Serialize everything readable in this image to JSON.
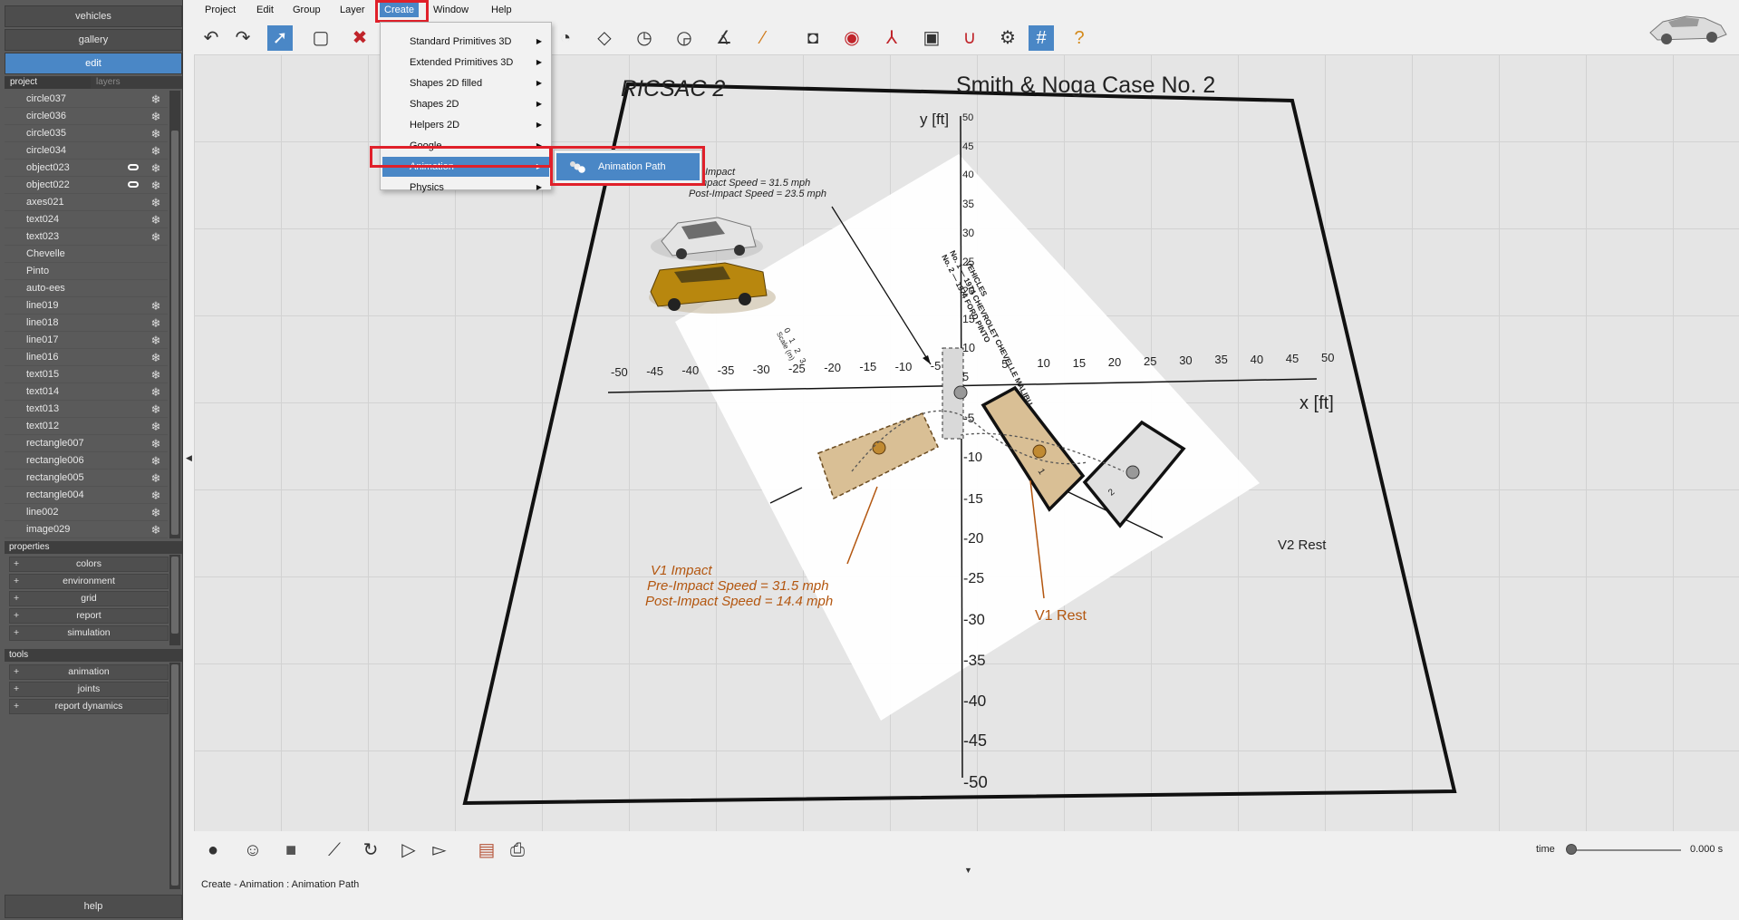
{
  "sidebar": {
    "top_buttons": [
      "vehicles",
      "gallery",
      "edit"
    ],
    "tabs": {
      "project": "project",
      "layers": "layers"
    },
    "project_items": [
      {
        "label": "circle037",
        "link": false,
        "gear": true
      },
      {
        "label": "circle036",
        "link": false,
        "gear": true
      },
      {
        "label": "circle035",
        "link": false,
        "gear": true
      },
      {
        "label": "circle034",
        "link": false,
        "gear": true
      },
      {
        "label": "object023",
        "link": true,
        "gear": true
      },
      {
        "label": "object022",
        "link": true,
        "gear": true
      },
      {
        "label": "axes021",
        "link": false,
        "gear": true
      },
      {
        "label": "text024",
        "link": false,
        "gear": true
      },
      {
        "label": "text023",
        "link": false,
        "gear": true
      },
      {
        "label": "Chevelle",
        "link": false,
        "gear": false
      },
      {
        "label": "Pinto",
        "link": false,
        "gear": false
      },
      {
        "label": "auto-ees",
        "link": false,
        "gear": false
      },
      {
        "label": "line019",
        "link": false,
        "gear": true
      },
      {
        "label": "line018",
        "link": false,
        "gear": true
      },
      {
        "label": "line017",
        "link": false,
        "gear": true
      },
      {
        "label": "line016",
        "link": false,
        "gear": true
      },
      {
        "label": "text015",
        "link": false,
        "gear": true
      },
      {
        "label": "text014",
        "link": false,
        "gear": true
      },
      {
        "label": "text013",
        "link": false,
        "gear": true
      },
      {
        "label": "text012",
        "link": false,
        "gear": true
      },
      {
        "label": "rectangle007",
        "link": false,
        "gear": true
      },
      {
        "label": "rectangle006",
        "link": false,
        "gear": true
      },
      {
        "label": "rectangle005",
        "link": false,
        "gear": true
      },
      {
        "label": "rectangle004",
        "link": false,
        "gear": true
      },
      {
        "label": "line002",
        "link": false,
        "gear": true
      },
      {
        "label": "image029",
        "link": false,
        "gear": true
      }
    ],
    "properties_title": "properties",
    "properties": [
      "colors",
      "environment",
      "grid",
      "report",
      "simulation"
    ],
    "tools_title": "tools",
    "tools": [
      "animation",
      "joints",
      "report dynamics"
    ],
    "help": "help"
  },
  "menubar": [
    "Project",
    "Edit",
    "Group",
    "Layer",
    "Create",
    "Window",
    "Help"
  ],
  "create_menu": {
    "items": [
      "Standard Primitives 3D",
      "Extended Primitives 3D",
      "Shapes 2D filled",
      "Shapes 2D",
      "Helpers 2D",
      "Google",
      "Animation",
      "Physics"
    ],
    "highlighted": "Animation",
    "submenu": [
      "Animation Path"
    ]
  },
  "scene": {
    "title_left": "RICSAC 2",
    "title_right": "Smith & Noga Case No. 2",
    "y_axis_label": "y [ft]",
    "x_axis_label": "x [ft]",
    "x_ticks": [
      "-50",
      "-45",
      "-40",
      "-35",
      "-30",
      "-25",
      "-20",
      "-15",
      "-10",
      "-5",
      "0",
      "5",
      "10",
      "15",
      "20",
      "25",
      "30",
      "35",
      "40",
      "45",
      "50"
    ],
    "y_ticks_pos": [
      "50",
      "45",
      "40",
      "35",
      "30",
      "25",
      "20",
      "15",
      "10",
      "5"
    ],
    "y_ticks_neg": [
      "-5",
      "-10",
      "-15",
      "-20",
      "-25",
      "-30",
      "-35",
      "-40",
      "-45",
      "-50"
    ],
    "v2_impact_lines": [
      "Impact",
      "Impact Speed = 31.5 mph",
      "Post-Impact Speed = 23.5 mph"
    ],
    "v1_impact_lines": [
      "V1 Impact",
      "Pre-Impact Speed = 31.5 mph",
      "Post-Impact Speed = 14.4 mph"
    ],
    "v1_rest": "V1 Rest",
    "v2_rest": "V2 Rest",
    "vehicles_note": [
      "VEHICLES",
      "No. 1 — 1974 CHEVROLET CHEVELLE MALIBU",
      "No. 2 — 1974 FORD PINTO"
    ],
    "scale_label": "Scale (m)",
    "scale_ticks": [
      "0",
      "1",
      "2",
      "3"
    ],
    "vehicle_tags": [
      "1",
      "2"
    ],
    "colors": {
      "accent": "#4a87c6",
      "highlight_frame": "#e0202a",
      "annotation": "#b3560f"
    }
  },
  "bottom": {
    "status": "Create - Animation : Animation Path",
    "time_label": "time",
    "time_value": "0.000 s"
  }
}
